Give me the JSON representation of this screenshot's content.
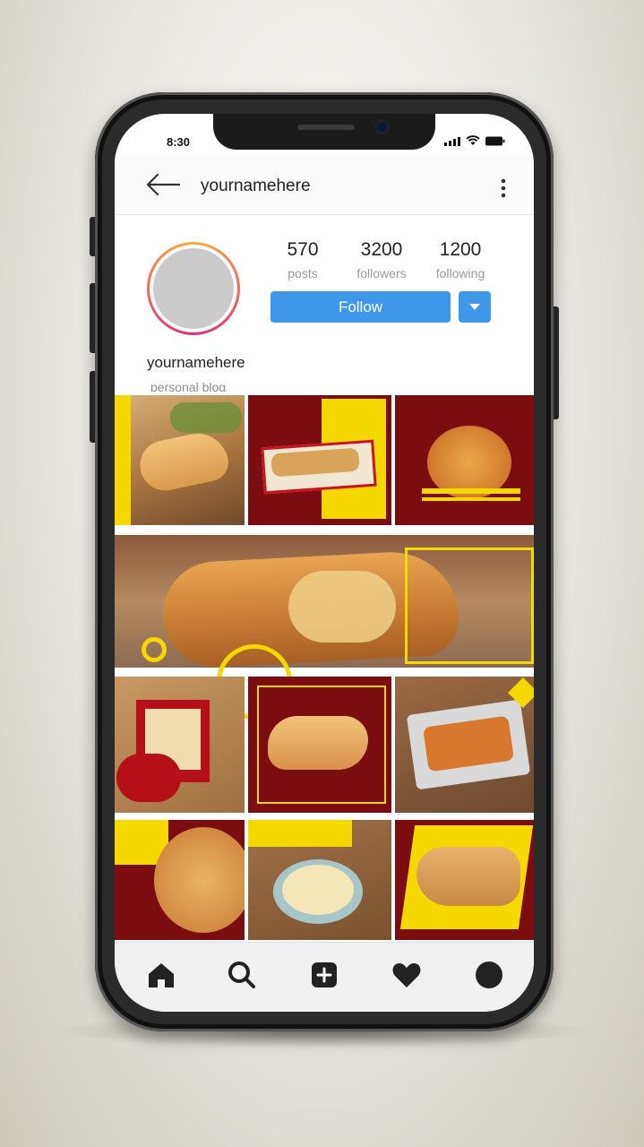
{
  "status_bar": {
    "time": "8:30"
  },
  "header": {
    "username": "yournamehere"
  },
  "profile": {
    "name": "yournamehere",
    "bio": "personal blog"
  },
  "stats": [
    {
      "value": "570",
      "label": "posts"
    },
    {
      "value": "3200",
      "label": "followers"
    },
    {
      "value": "1200",
      "label": "following"
    }
  ],
  "actions": {
    "follow_label": "Follow"
  },
  "colors": {
    "accent_blue": "#3f97ea",
    "brand_maroon": "#7b0c10",
    "brand_yellow": "#f5d800"
  },
  "posts": [
    {
      "subject": "stuffed flatbread with tea"
    },
    {
      "subject": "sandwich box"
    },
    {
      "subject": "pizza on board"
    },
    {
      "subject": "grilled wrap banner"
    },
    {
      "subject": "wrap sandwiches"
    },
    {
      "subject": "folded wrap"
    },
    {
      "subject": "fried platter tray"
    },
    {
      "subject": "pizza slice"
    },
    {
      "subject": "hummus bowl"
    },
    {
      "subject": "flatbread on rack"
    }
  ],
  "tabbar": {
    "icons": [
      "home-icon",
      "search-icon",
      "add-post-icon",
      "heart-icon",
      "profile-icon"
    ]
  }
}
